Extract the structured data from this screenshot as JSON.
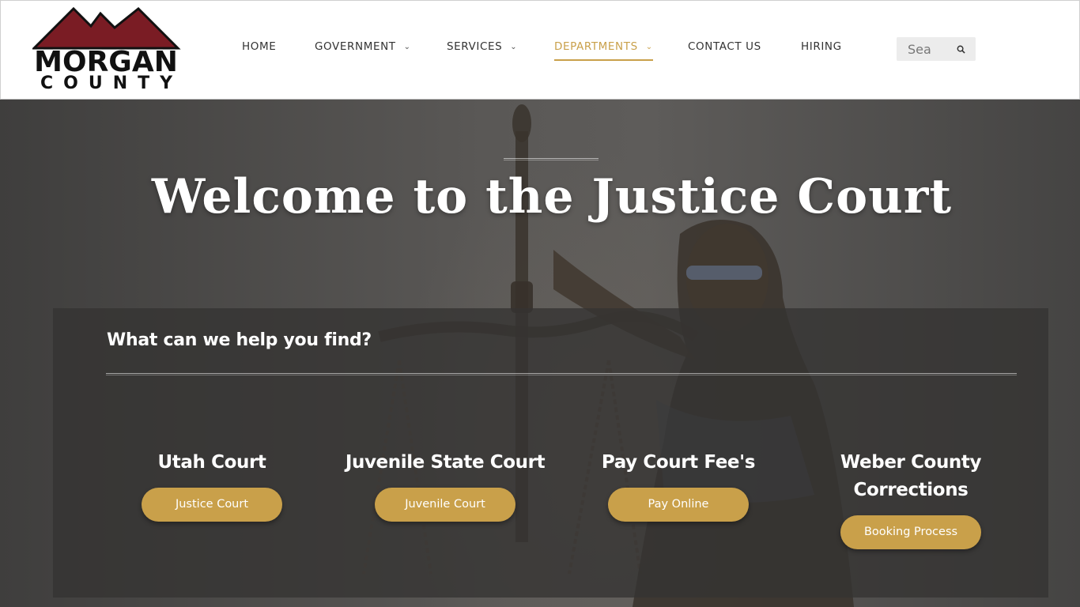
{
  "logo": {
    "line1": "MORGAN",
    "line2": "COUNTY",
    "brand_color": "#7a1c24"
  },
  "nav": {
    "items": [
      {
        "label": "HOME",
        "dropdown": false
      },
      {
        "label": "GOVERNMENT",
        "dropdown": true
      },
      {
        "label": "SERVICES",
        "dropdown": true
      },
      {
        "label": "DEPARTMENTS",
        "dropdown": true,
        "active": true
      },
      {
        "label": "CONTACT US",
        "dropdown": false
      },
      {
        "label": "HIRING",
        "dropdown": false
      }
    ],
    "active_color": "#c9a04a"
  },
  "search": {
    "placeholder": "Sea",
    "icon": "search-icon"
  },
  "hero": {
    "title": "Welcome to the Justice Court"
  },
  "panel": {
    "heading": "What can we help you find?",
    "cards": [
      {
        "title": "Utah Court",
        "button": "Justice Court"
      },
      {
        "title": "Juvenile State Court",
        "button": "Juvenile Court"
      },
      {
        "title": "Pay Court Fee's",
        "button": "Pay Online"
      },
      {
        "title": "Weber County Corrections",
        "button": "Booking Process"
      }
    ],
    "button_color": "#c9a04a"
  }
}
